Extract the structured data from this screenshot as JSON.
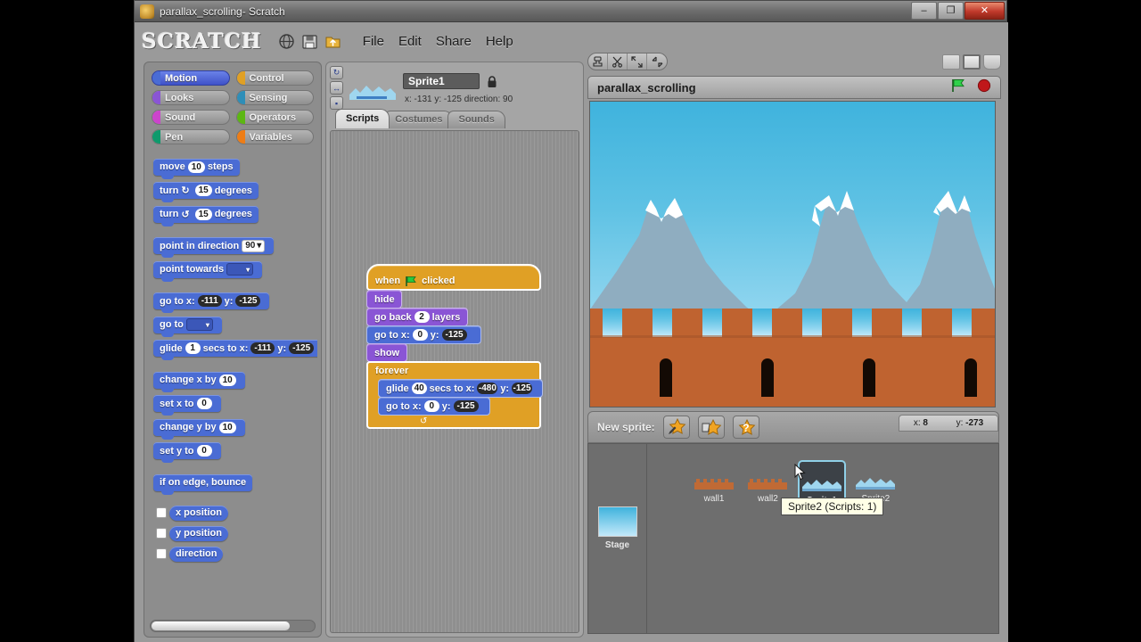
{
  "window": {
    "title": "parallax_scrolling- Scratch",
    "app_icon": "scratch-cat-icon",
    "buttons": {
      "minimize": "–",
      "maximize": "❐",
      "close": "✕"
    }
  },
  "menubar": {
    "logo": "SCRATCH",
    "icons": [
      "globe-icon",
      "save-icon",
      "share-folder-icon"
    ],
    "items": [
      "File",
      "Edit",
      "Share",
      "Help"
    ]
  },
  "palette": {
    "categories": [
      {
        "label": "Motion",
        "color": "#4a6cd4",
        "selected": true
      },
      {
        "label": "Control",
        "color": "#e0a025",
        "selected": false
      },
      {
        "label": "Looks",
        "color": "#8a55d5",
        "selected": false
      },
      {
        "label": "Sensing",
        "color": "#2e8eb8",
        "selected": false
      },
      {
        "label": "Sound",
        "color": "#cc44cc",
        "selected": false
      },
      {
        "label": "Operators",
        "color": "#5cb712",
        "selected": false
      },
      {
        "label": "Pen",
        "color": "#0e9a6c",
        "selected": false
      },
      {
        "label": "Variables",
        "color": "#ee7d16",
        "selected": false
      }
    ],
    "blocks": {
      "move_label_1": "move",
      "move_value": "10",
      "move_label_2": "steps",
      "turn_cw_label": "turn",
      "turn_cw_icon": "↻",
      "turn_cw_value": "15",
      "turn_cw_units": "degrees",
      "turn_ccw_label": "turn",
      "turn_ccw_icon": "↺",
      "turn_ccw_value": "15",
      "turn_ccw_units": "degrees",
      "point_dir_label": "point in direction",
      "point_dir_value": "90",
      "point_towards_label": "point towards",
      "goto_xy_label_1": "go to x:",
      "goto_xy_x": "-111",
      "goto_xy_label_2": "y:",
      "goto_xy_y": "-125",
      "goto_label": "go to",
      "glide_label_1": "glide",
      "glide_secs": "1",
      "glide_label_2": "secs to x:",
      "glide_x": "-111",
      "glide_label_3": "y:",
      "glide_y": "-125",
      "change_x_label": "change x by",
      "change_x_value": "10",
      "set_x_label": "set x to",
      "set_x_value": "0",
      "change_y_label": "change y by",
      "change_y_value": "10",
      "set_y_label": "set y to",
      "set_y_value": "0",
      "bounce_label": "if on edge, bounce",
      "x_position": "x position",
      "y_position": "y position",
      "direction": "direction"
    }
  },
  "sprite_header": {
    "rotation_buttons": [
      "rotate-freely-icon",
      "left-right-flip-icon",
      "no-rotate-icon"
    ],
    "sprite_name": "Sprite1",
    "lock_icon": "lock-icon",
    "coords": "x: -131 y: -125 direction: 90",
    "tabs": [
      {
        "label": "Scripts",
        "active": true
      },
      {
        "label": "Costumes",
        "active": false
      },
      {
        "label": "Sounds",
        "active": false
      }
    ]
  },
  "script": {
    "hat": {
      "prefix": "when",
      "flag": "green-flag-icon",
      "suffix": "clicked"
    },
    "blocks": [
      {
        "type": "looks",
        "text": "hide"
      },
      {
        "type": "looks",
        "text_1": "go back",
        "value": "2",
        "text_2": "layers"
      },
      {
        "type": "motion",
        "text_1": "go to x:",
        "x": "0",
        "text_2": "y:",
        "y": "-125"
      },
      {
        "type": "looks",
        "text": "show"
      }
    ],
    "forever": {
      "label": "forever",
      "loop_arrow": "↺",
      "inner": [
        {
          "type": "motion",
          "text_1": "glide",
          "secs": "40",
          "text_2": "secs to x:",
          "x": "-480",
          "text_3": "y:",
          "y": "-125"
        },
        {
          "type": "motion",
          "text_1": "go to x:",
          "x": "0",
          "text_2": "y:",
          "y": "-125"
        }
      ]
    }
  },
  "stage_toolbar": {
    "tools": [
      "stamp-duplicate-icon",
      "scissors-cut-icon",
      "grow-icon",
      "shrink-icon"
    ],
    "views": [
      {
        "name": "small-stage-view-button",
        "active": false
      },
      {
        "name": "normal-stage-view-button",
        "active": true
      },
      {
        "name": "presentation-mode-button",
        "active": false
      }
    ]
  },
  "project": {
    "name": "parallax_scrolling",
    "green_flag": "green-flag-icon",
    "stop_sign": "stop-sign-icon"
  },
  "stage": {
    "sky_top": "#3fb3dd",
    "sky_bottom": "#c3e9fa",
    "mountain_color": "#8aa9bd",
    "snow_color": "#ffffff",
    "wall_color": "#bf6330",
    "wall_dark": "#1c1008",
    "mouse_x_label": "x:",
    "mouse_x": "8",
    "mouse_y_label": "y:",
    "mouse_y": "-273"
  },
  "sprite_pane": {
    "new_sprite_label": "New sprite:",
    "new_sprite_buttons": [
      "paint-new-sprite-icon",
      "choose-new-sprite-icon",
      "surprise-sprite-icon"
    ],
    "stage_label": "Stage",
    "sprites": [
      {
        "name": "wall1",
        "selected": false,
        "thumb": "wall-thumb"
      },
      {
        "name": "wall2",
        "selected": false,
        "thumb": "wall-thumb"
      },
      {
        "name": "Sprite1",
        "selected": true,
        "thumb": "mountain-thumb"
      },
      {
        "name": "Sprite2",
        "selected": false,
        "thumb": "mountain-thumb"
      }
    ],
    "tooltip": "Sprite2 (Scripts: 1)"
  }
}
